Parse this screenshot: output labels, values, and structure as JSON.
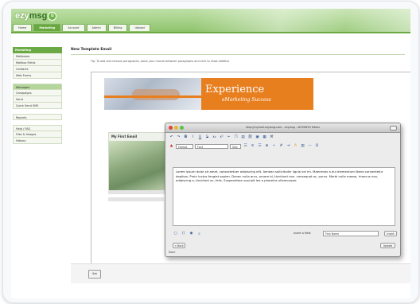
{
  "header": {
    "logo_easy": "ezy",
    "logo_msg": "msg",
    "logo_badge": "ü",
    "tabs": [
      {
        "label": "Home"
      },
      {
        "label": "Marketing"
      },
      {
        "label": "Account"
      },
      {
        "label": "Admin"
      },
      {
        "label": "Billing"
      },
      {
        "label": "Upload"
      }
    ]
  },
  "sidebar": {
    "groups": [
      {
        "title": "Marketing",
        "items": [
          "Mailboxes",
          "Mailbox Fields",
          "Contacts",
          "Web Forms"
        ]
      },
      {
        "title": "",
        "items": [
          "Messages",
          "Campaigns",
          "Send",
          "Quick Send SMS"
        ]
      },
      {
        "title": "",
        "items": [
          "Reports"
        ]
      },
      {
        "title": "",
        "items": [
          "Help / FAQ",
          "Files & Images",
          "History"
        ]
      }
    ]
  },
  "main": {
    "title": "New Template Email",
    "hint": "Tip: To add text remove paragraphs, place your mouse between paragraphs and click to show additive",
    "save_label": "Set"
  },
  "template": {
    "banner_headline": "Experience",
    "banner_tagline": "eMarketing Success",
    "card_title": "My First Email"
  },
  "popup": {
    "title": "http://mymail.ezymsg.com - ezymsg - WYSIWYG Editor",
    "format_select": "Format",
    "font_select": "Font",
    "size_select": "Size",
    "body_text": "Lorem ipsum dolor sit amet, consectetuer adipiscing elit. Aenean sollicitudin ligula vel mi. Maecenas a dui elementum libero consectetur dapibus. Proin luctus feugiat sapien. Donec nulla arcu, ornare id, tincidunt non, consequat ac, purus. Morbi nulla massa, rhoncus non, adipiscing a, tincidunt ac, felis. Suspendisse suscipit leo a pharetra ullamcorper.",
    "insert_label": "Insert a field:",
    "font_field": "First Name",
    "insert_button": "Insert",
    "back_button": "< Back",
    "update_button": "Update",
    "status": "Done"
  },
  "colors": {
    "brand_green": "#6aa944",
    "banner_orange": "#e87f1f"
  }
}
